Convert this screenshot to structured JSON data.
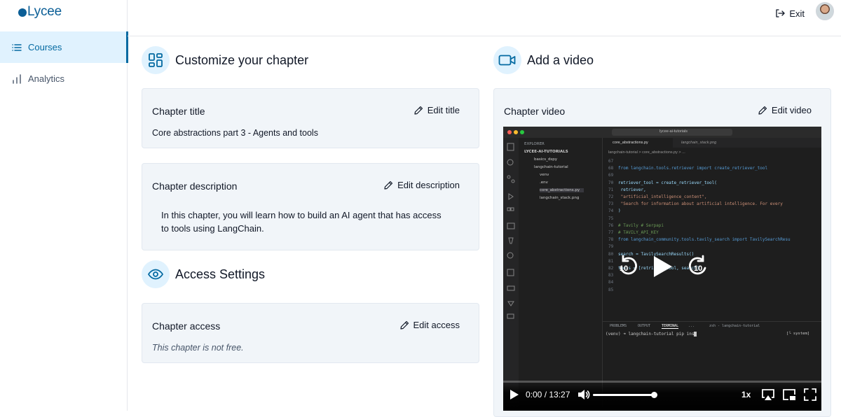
{
  "app": {
    "name": "Lycee",
    "brand_color": "#0b5e96",
    "accent_color": "#0369a1"
  },
  "sidebar": {
    "items": [
      {
        "label": "Courses",
        "icon": "list-icon",
        "active": true
      },
      {
        "label": "Analytics",
        "icon": "bar-chart-icon",
        "active": false
      }
    ]
  },
  "topbar": {
    "exit_label": "Exit",
    "exit_icon": "log-out-icon",
    "avatar": "user-avatar"
  },
  "customize": {
    "heading": "Customize your chapter",
    "heading_icon": "layout-dashboard-icon",
    "title_card": {
      "label": "Chapter title",
      "action": "Edit title",
      "value": "Core abstractions part 3 - Agents and tools"
    },
    "description_card": {
      "label": "Chapter description",
      "action": "Edit description",
      "value_line1": "In this chapter, you will learn how to build an AI agent that has access",
      "value_line2": "to tools using LangChain."
    }
  },
  "access": {
    "heading": "Access Settings",
    "heading_icon": "eye-icon",
    "card": {
      "label": "Chapter access",
      "action": "Edit access",
      "value": "This chapter is not free."
    }
  },
  "video_section": {
    "heading": "Add a video",
    "heading_icon": "video-icon",
    "card": {
      "label": "Chapter video",
      "action": "Edit video"
    },
    "player": {
      "current_time": "0:00",
      "duration": "13:27",
      "time_display": "0:00 / 13:27",
      "progress": 0,
      "volume": 1.0,
      "speed": "1x",
      "skip_back_seconds": "10",
      "skip_forward_seconds": "10"
    },
    "screen": {
      "window_title": "lycee-ai-tutorials",
      "tab_active": "core_abstractions.py",
      "tab_other": "langchain_stack.png",
      "breadcrumb": "langchain-tutorial > core_abstractions.py > ...",
      "explorer_title": "EXPLORER",
      "explorer_root": "LYCEE-AI-TUTORIALS",
      "explorer_items": [
        "basics_dspy",
        "langchain-tutorial",
        "venv",
        ".env",
        "core_abstractions.py",
        "langchain_stack.png"
      ],
      "code": [
        {
          "n": "67",
          "t": ""
        },
        {
          "n": "68",
          "t": "from langchain.tools.retriever import create_retriever_tool"
        },
        {
          "n": "69",
          "t": ""
        },
        {
          "n": "70",
          "t": "retriever_tool = create_retriever_tool("
        },
        {
          "n": "71",
          "t": "    retriever,"
        },
        {
          "n": "72",
          "t": "    \"artificial_intelligence_content\","
        },
        {
          "n": "73",
          "t": "    \"Search for information about artificial intelligence. For every"
        },
        {
          "n": "74",
          "t": ")"
        },
        {
          "n": "75",
          "t": ""
        },
        {
          "n": "76",
          "t": "# Tavily # Serpapi"
        },
        {
          "n": "77",
          "t": "# TAVILY_API_KEY"
        },
        {
          "n": "78",
          "t": "from langchain_community.tools.tavily_search import TavilySearchResu"
        },
        {
          "n": "79",
          "t": ""
        },
        {
          "n": "80",
          "t": "search = TavilySearchResults()"
        },
        {
          "n": "81",
          "t": ""
        },
        {
          "n": "82",
          "t": "tools = [retriever_tool, search]"
        },
        {
          "n": "83",
          "t": ""
        },
        {
          "n": "84",
          "t": ""
        },
        {
          "n": "85",
          "t": ""
        }
      ],
      "panel_tabs": [
        "PROBLEMS",
        "OUTPUT",
        "TERMINAL",
        "..."
      ],
      "panel_right": "zsh - langchain-tutorial",
      "terminal_line": "(venv) ➜  langchain-tutorial pip ins",
      "terminal_right": "[└ system]"
    }
  }
}
